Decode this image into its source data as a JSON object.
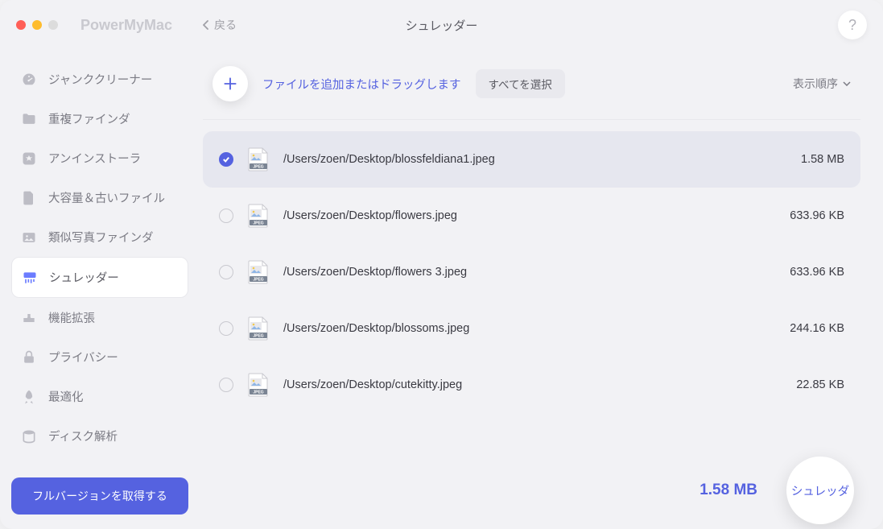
{
  "app": {
    "name": "PowerMyMac",
    "back": "戻る",
    "title": "シュレッダー",
    "help": "?"
  },
  "sidebar": {
    "items": [
      {
        "label": "ジャンククリーナー"
      },
      {
        "label": "重複ファインダ"
      },
      {
        "label": "アンインストーラ"
      },
      {
        "label": "大容量＆古いファイル"
      },
      {
        "label": "類似写真ファインダ"
      },
      {
        "label": "シュレッダー"
      },
      {
        "label": "機能拡張"
      },
      {
        "label": "プライバシー"
      },
      {
        "label": "最適化"
      },
      {
        "label": "ディスク解析"
      }
    ],
    "full_version_btn": "フルバージョンを取得する"
  },
  "toolbar": {
    "drag_label": "ファイルを追加またはドラッグします",
    "select_all": "すべてを選択",
    "sort": "表示順序"
  },
  "files": [
    {
      "path": "/Users/zoen/Desktop/blossfeldiana1.jpeg",
      "size": "1.58 MB",
      "selected": true
    },
    {
      "path": "/Users/zoen/Desktop/flowers.jpeg",
      "size": "633.96 KB",
      "selected": false
    },
    {
      "path": "/Users/zoen/Desktop/flowers 3.jpeg",
      "size": "633.96 KB",
      "selected": false
    },
    {
      "path": "/Users/zoen/Desktop/blossoms.jpeg",
      "size": "244.16 KB",
      "selected": false
    },
    {
      "path": "/Users/zoen/Desktop/cutekitty.jpeg",
      "size": "22.85 KB",
      "selected": false
    }
  ],
  "footer": {
    "total": "1.58 MB",
    "shred_btn": "シュレッダ"
  },
  "icons": {
    "jpeg_label": "JPEG"
  },
  "colors": {
    "accent": "#5562e0"
  }
}
